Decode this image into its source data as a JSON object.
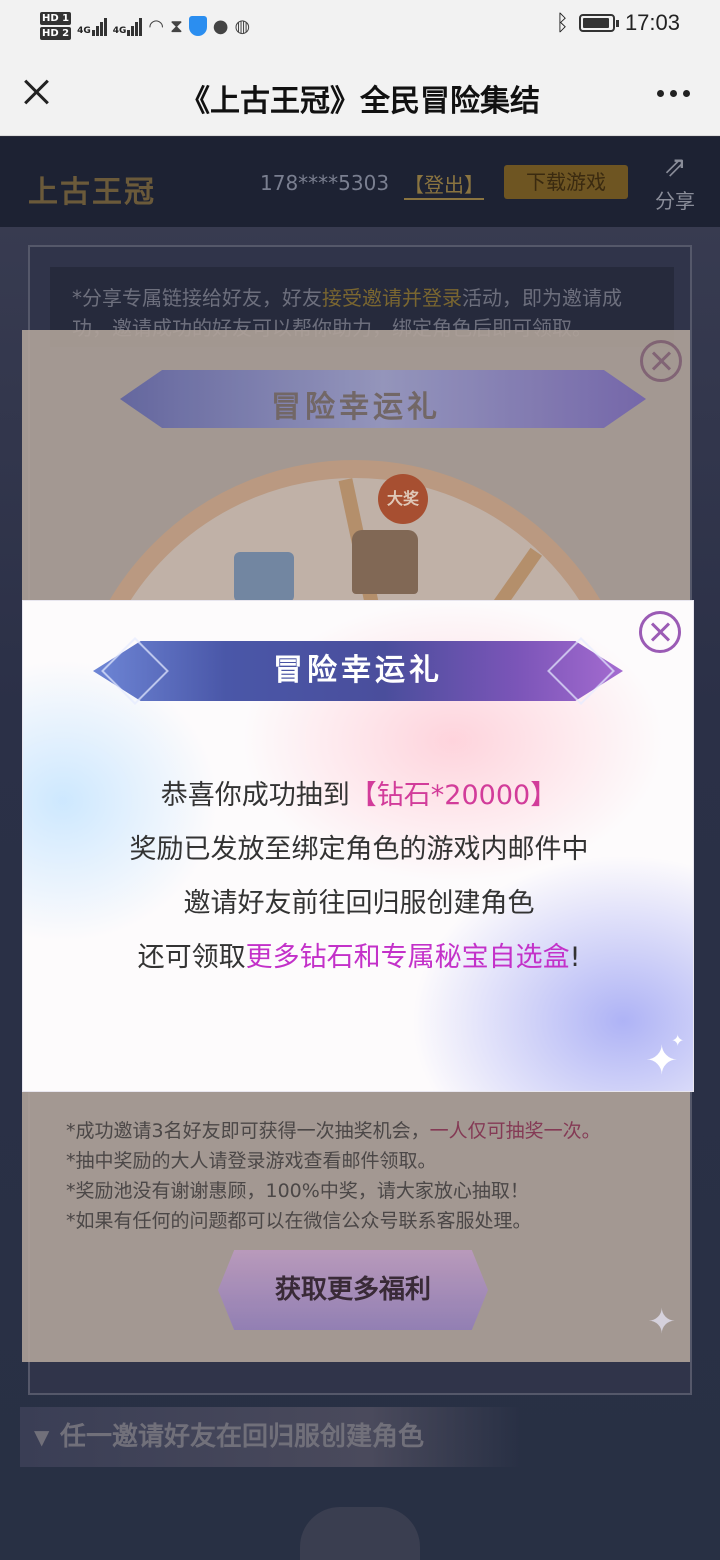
{
  "status_bar": {
    "hd1": "HD 1",
    "hd2": "HD 2",
    "network1": "4G",
    "network2": "4G",
    "time": "17:03"
  },
  "title_bar": {
    "title": "《上古王冠》全民冒险集结"
  },
  "page": {
    "logo": "上古王冠",
    "phone": "178****5303",
    "logout": "【登出】",
    "download": "下载游戏",
    "share": "分享",
    "tip_prefix": "*分享专属链接给好友，好友",
    "tip_highlight": "接受邀请并登录",
    "tip_suffix": "活动，即为邀请成功，邀请成功的好友可以帮你助力，绑定角色后即可领取。",
    "section_title": "任一邀请好友在回归服创建角色"
  },
  "wheel_dialog": {
    "title": "冒险幸运礼",
    "badge": "大奖",
    "rules": [
      {
        "text": "*成功邀请3名好友即可获得一次抽奖机会，",
        "highlight": "一人仅可抽奖一次。"
      },
      {
        "text": "*抽中奖励的大人请登录游戏查看邮件领取。",
        "highlight": ""
      },
      {
        "text": "*奖励池没有谢谢惠顾，100%中奖，请大家放心抽取！",
        "highlight": ""
      },
      {
        "text": "*如果有任何的问题都可以在微信公众号联系客服处理。",
        "highlight": ""
      }
    ],
    "button": "获取更多福利"
  },
  "result_dialog": {
    "title": "冒险幸运礼",
    "line1_prefix": "恭喜你成功抽到",
    "line1_prize": "【钻石*20000】",
    "line2": "奖励已发放至绑定角色的游戏内邮件中",
    "line3": "邀请好友前往回归服创建角色",
    "line4_prefix": "还可领取",
    "line4_highlight": "更多钻石和专属秘宝自选盒",
    "line4_suffix": "!"
  },
  "colors": {
    "prize_pink": "#d23c9a",
    "highlight_magenta": "#c331c9",
    "ribbon_purple": "#4a4e9c",
    "close_purple": "#9b5bb5"
  },
  "icons": [
    "bluetooth-icon",
    "battery-icon",
    "wifi-icon",
    "hourglass-icon",
    "shield-icon",
    "wechat-icon",
    "browser-icon",
    "close-icon",
    "more-icon",
    "share-icon",
    "sparkle-icon"
  ]
}
